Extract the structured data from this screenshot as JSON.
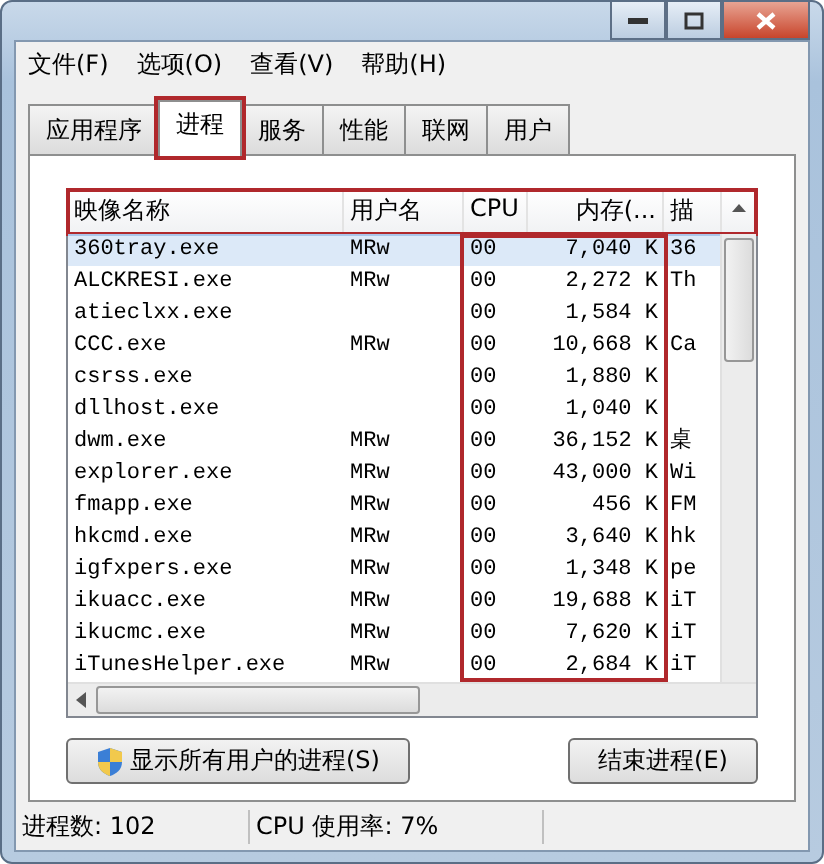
{
  "menu": [
    "文件(F)",
    "选项(O)",
    "查看(V)",
    "帮助(H)"
  ],
  "tabs": [
    {
      "label": "应用程序",
      "selected": false,
      "highlighted": false
    },
    {
      "label": "进程",
      "selected": true,
      "highlighted": true
    },
    {
      "label": "服务",
      "selected": false,
      "highlighted": false
    },
    {
      "label": "性能",
      "selected": false,
      "highlighted": false
    },
    {
      "label": "联网",
      "selected": false,
      "highlighted": false
    },
    {
      "label": "用户",
      "selected": false,
      "highlighted": false
    }
  ],
  "table": {
    "header_highlighted": true,
    "columns": [
      {
        "label": "映像名称",
        "highlighted": false
      },
      {
        "label": "用户名",
        "highlighted": false
      },
      {
        "label": "CPU",
        "highlighted": true
      },
      {
        "label": "内存(...",
        "highlighted": true
      },
      {
        "label": "描",
        "highlighted": false
      }
    ],
    "rows": [
      {
        "selected": true,
        "cells": [
          "360tray.exe",
          "MRw",
          "00",
          "7,040 K",
          "36"
        ]
      },
      {
        "selected": false,
        "cells": [
          "ALCKRESI.exe",
          "MRw",
          "00",
          "2,272 K",
          "Th"
        ]
      },
      {
        "selected": false,
        "cells": [
          "atieclxx.exe",
          "",
          "00",
          "1,584 K",
          ""
        ]
      },
      {
        "selected": false,
        "cells": [
          "CCC.exe",
          "MRw",
          "00",
          "10,668 K",
          "Ca"
        ]
      },
      {
        "selected": false,
        "cells": [
          "csrss.exe",
          "",
          "00",
          "1,880 K",
          ""
        ]
      },
      {
        "selected": false,
        "cells": [
          "dllhost.exe",
          "",
          "00",
          "1,040 K",
          ""
        ]
      },
      {
        "selected": false,
        "cells": [
          "dwm.exe",
          "MRw",
          "00",
          "36,152 K",
          "桌"
        ]
      },
      {
        "selected": false,
        "cells": [
          "explorer.exe",
          "MRw",
          "00",
          "43,000 K",
          "Wi"
        ]
      },
      {
        "selected": false,
        "cells": [
          "fmapp.exe",
          "MRw",
          "00",
          "456 K",
          "FM"
        ]
      },
      {
        "selected": false,
        "cells": [
          "hkcmd.exe",
          "MRw",
          "00",
          "3,640 K",
          "hk"
        ]
      },
      {
        "selected": false,
        "cells": [
          "igfxpers.exe",
          "MRw",
          "00",
          "1,348 K",
          "pe"
        ]
      },
      {
        "selected": false,
        "cells": [
          "ikuacc.exe",
          "MRw",
          "00",
          "19,688 K",
          "iT"
        ]
      },
      {
        "selected": false,
        "cells": [
          "ikucmc.exe",
          "MRw",
          "00",
          "7,620 K",
          "iT"
        ]
      },
      {
        "selected": false,
        "cells": [
          "iTunesHelper.exe",
          "MRw",
          "00",
          "2,684 K",
          "iT"
        ]
      }
    ]
  },
  "buttons": [
    {
      "label": "显示所有用户的进程(S)",
      "kind": "shield"
    },
    {
      "label": "结束进程(E)",
      "kind": "plain"
    }
  ],
  "status_bar": [
    "进程数: 102",
    "CPU 使用率: 7%"
  ]
}
